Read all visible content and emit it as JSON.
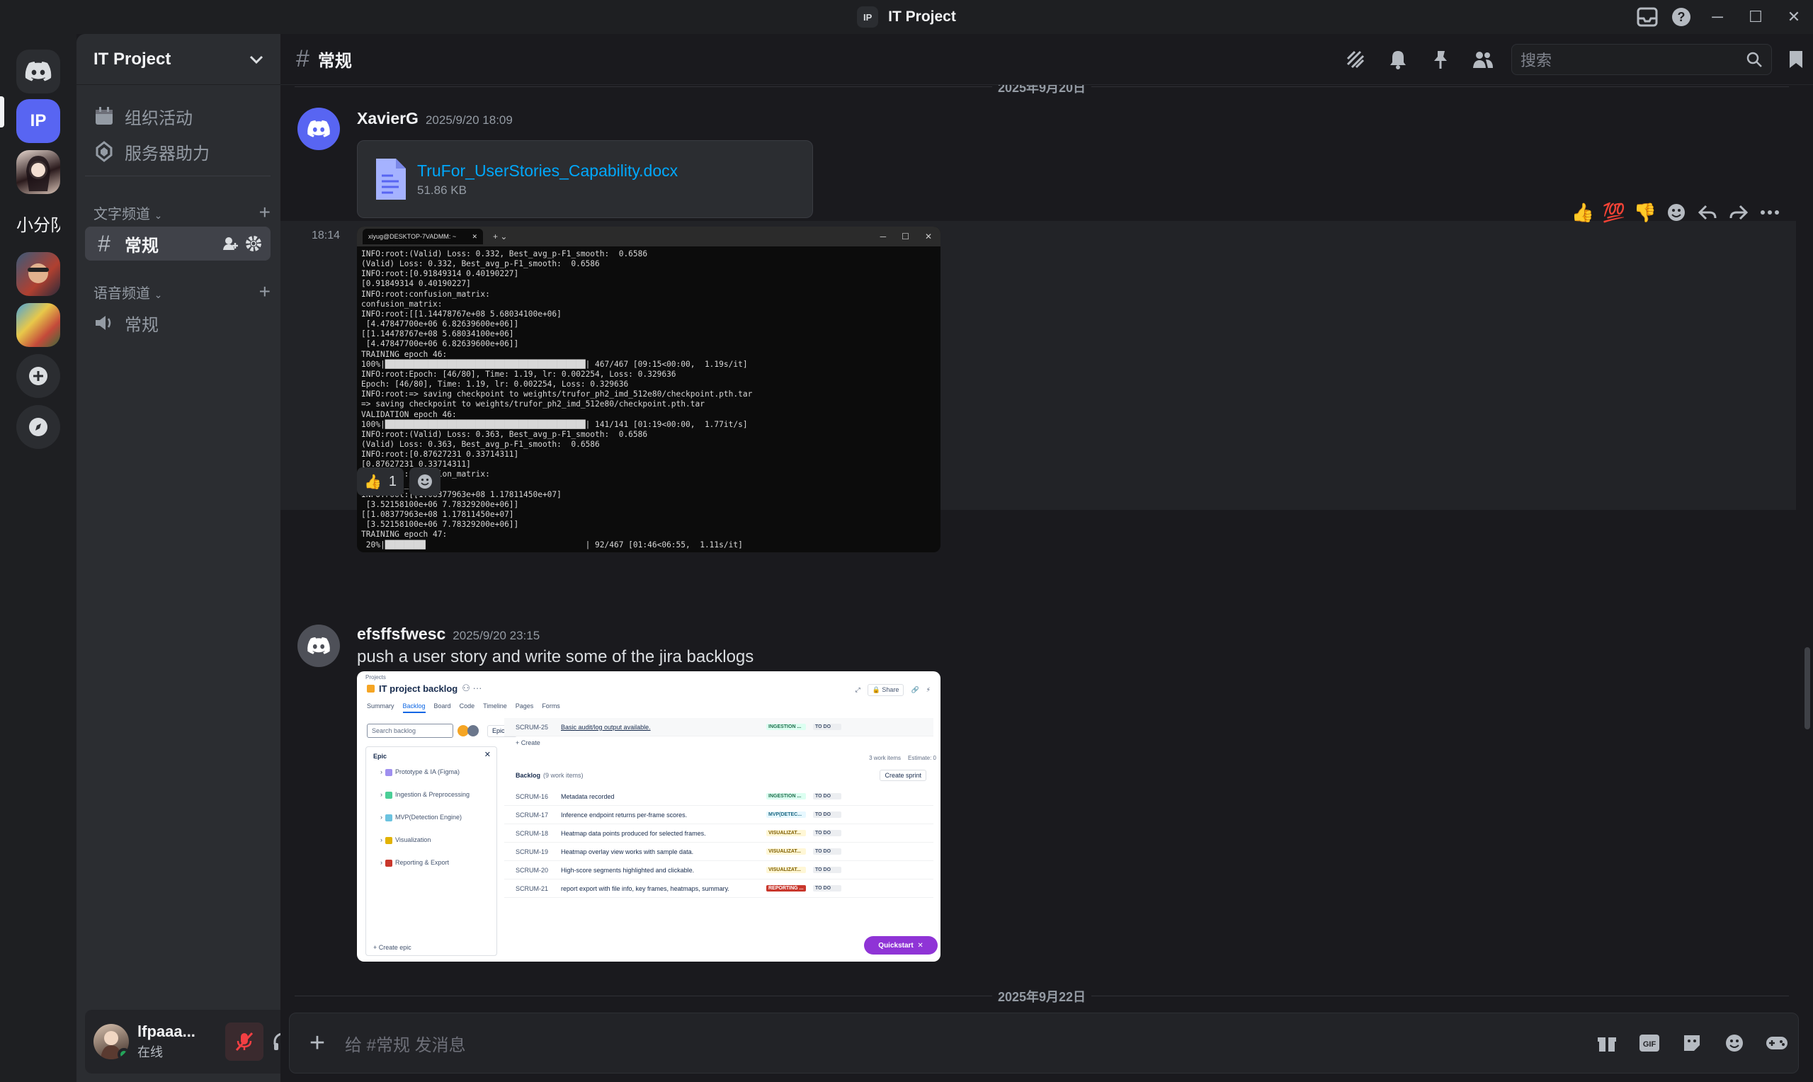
{
  "window": {
    "title": "IT Project",
    "server_badge": "IP"
  },
  "guilds": {
    "home_badge": "IP",
    "folder_label": "小分队"
  },
  "sidebar": {
    "server_name": "IT Project",
    "events": "组织活动",
    "boost": "服务器助力",
    "text_category": "文字频道",
    "voice_category": "语音频道",
    "text_channel": "常规",
    "voice_channel": "常规"
  },
  "user": {
    "name": "lfpaaa...",
    "status": "在线"
  },
  "channel": {
    "name": "常规",
    "search_placeholder": "搜索"
  },
  "messages": {
    "top_date": "2025年9月20日",
    "m1": {
      "author": "XavierG",
      "timestamp": "2025/9/20 18:09",
      "file_name": "TruFor_UserStories_Capability.docx",
      "file_size": "51.86 KB"
    },
    "m2": {
      "side_time": "18:14",
      "terminal_tab": "xiyug@DESKTOP-7VADMM: ~",
      "terminal_lines": [
        "INFO:root:(Valid) Loss: 0.332, Best_avg_p-F1_smooth:  0.6586",
        "(Valid) Loss: 0.332, Best_avg_p-F1_smooth:  0.6586",
        "INFO:root:[0.91849314 0.40190227]",
        "[0.91849314 0.40190227]",
        "INFO:root:confusion_matrix:",
        "confusion_matrix:",
        "INFO:root:[[1.14478767e+08 5.68034100e+06]",
        " [4.47847700e+06 6.82639600e+06]]",
        "[[1.14478767e+08 5.68034100e+06]",
        " [4.47847700e+06 6.82639600e+06]]",
        "TRAINING epoch 46:",
        "100%|██████████████████████████████████████████| 467/467 [09:15<00:00,  1.19s/it]",
        "INFO:root:Epoch: [46/80], Time: 1.19, lr: 0.002254, Loss: 0.329636",
        "Epoch: [46/80], Time: 1.19, lr: 0.002254, Loss: 0.329636",
        "INFO:root:=> saving checkpoint to weights/trufor_ph2_imd_512e80/checkpoint.pth.tar",
        "=> saving checkpoint to weights/trufor_ph2_imd_512e80/checkpoint.pth.tar",
        "VALIDATION epoch 46:",
        "100%|██████████████████████████████████████████| 141/141 [01:19<00:00,  1.77it/s]",
        "INFO:root:(Valid) Loss: 0.363, Best_avg_p-F1_smooth:  0.6586",
        "(Valid) Loss: 0.363, Best_avg_p-F1_smooth:  0.6586",
        "INFO:root:[0.87627231 0.33714311]",
        "[0.87627231 0.33714311]",
        "INFO:root:confusion_matrix:",
        "confusion_matrix:",
        "INFO:root:[[1.08377963e+08 1.17811450e+07]",
        " [3.52158100e+06 7.78329200e+06]]",
        "[[1.08377963e+08 1.17811450e+07]",
        " [3.52158100e+06 7.78329200e+06]]",
        "TRAINING epoch 47:",
        " 20%|████████▌                                 | 92/467 [01:46<06:55,  1.11s/it]"
      ],
      "reaction_count": "1"
    },
    "m3": {
      "author": "efsffsfwesc",
      "timestamp": "2025/9/20 23:15",
      "text": "push a user story and write some of the jira backlogs"
    },
    "bottom_date": "2025年9月22日"
  },
  "jira": {
    "crumb": "Projects",
    "title": "IT project backlog",
    "tabs": [
      "Summary",
      "Backlog",
      "Board",
      "Code",
      "Timeline",
      "Pages",
      "Forms"
    ],
    "search_placeholder": "Search backlog",
    "epic_filter": "Epic",
    "epic_header": "Epic",
    "epics": [
      {
        "name": "Prototype & IA (Figma)",
        "color": "#9f8fef"
      },
      {
        "name": "Ingestion & Preprocessing",
        "color": "#4bce97"
      },
      {
        "name": "MVP(Detection Engine)",
        "color": "#6cc3e0"
      },
      {
        "name": "Visualization",
        "color": "#e2b203"
      },
      {
        "name": "Reporting & Export",
        "color": "#c9372c"
      }
    ],
    "create_epic": "+ Create epic",
    "top_item": {
      "key": "SCRUM-25",
      "summary": "Basic audit/log output available.",
      "label": "INGESTION ...",
      "status": "TO DO"
    },
    "create": "+ Create",
    "work_items": "3 work items",
    "estimate": "Estimate: 0",
    "backlog_title": "Backlog",
    "backlog_count": "(9 work items)",
    "create_sprint": "Create sprint",
    "rows": [
      {
        "key": "SCRUM-16",
        "summary": "Metadata recorded",
        "label": "INGESTION ...",
        "lcolor": "#dcfff1",
        "ltext": "#216e4e",
        "status": "TO DO"
      },
      {
        "key": "SCRUM-17",
        "summary": "Inference endpoint returns per-frame scores.",
        "label": "MVP(DETEC...",
        "lcolor": "#e7f8ff",
        "ltext": "#206a83",
        "status": "TO DO"
      },
      {
        "key": "SCRUM-18",
        "summary": "Heatmap data points produced for selected frames.",
        "label": "VISUALIZAT...",
        "lcolor": "#fff7d6",
        "ltext": "#7f5f01",
        "status": "TO DO"
      },
      {
        "key": "SCRUM-19",
        "summary": "Heatmap overlay view works with sample data.",
        "label": "VISUALIZAT...",
        "lcolor": "#fff7d6",
        "ltext": "#7f5f01",
        "status": "TO DO"
      },
      {
        "key": "SCRUM-20",
        "summary": "High-score segments highlighted and clickable.",
        "label": "VISUALIZAT...",
        "lcolor": "#fff7d6",
        "ltext": "#7f5f01",
        "status": "TO DO"
      },
      {
        "key": "SCRUM-21",
        "summary": "report export with file info, key frames, heatmaps, summary.",
        "label": "REPORTING ...",
        "lcolor": "#c9372c",
        "ltext": "#ffffff",
        "status": "TO DO"
      }
    ],
    "quickstart": "Quickstart"
  },
  "composer": {
    "placeholder": "给 #常规 发消息"
  }
}
